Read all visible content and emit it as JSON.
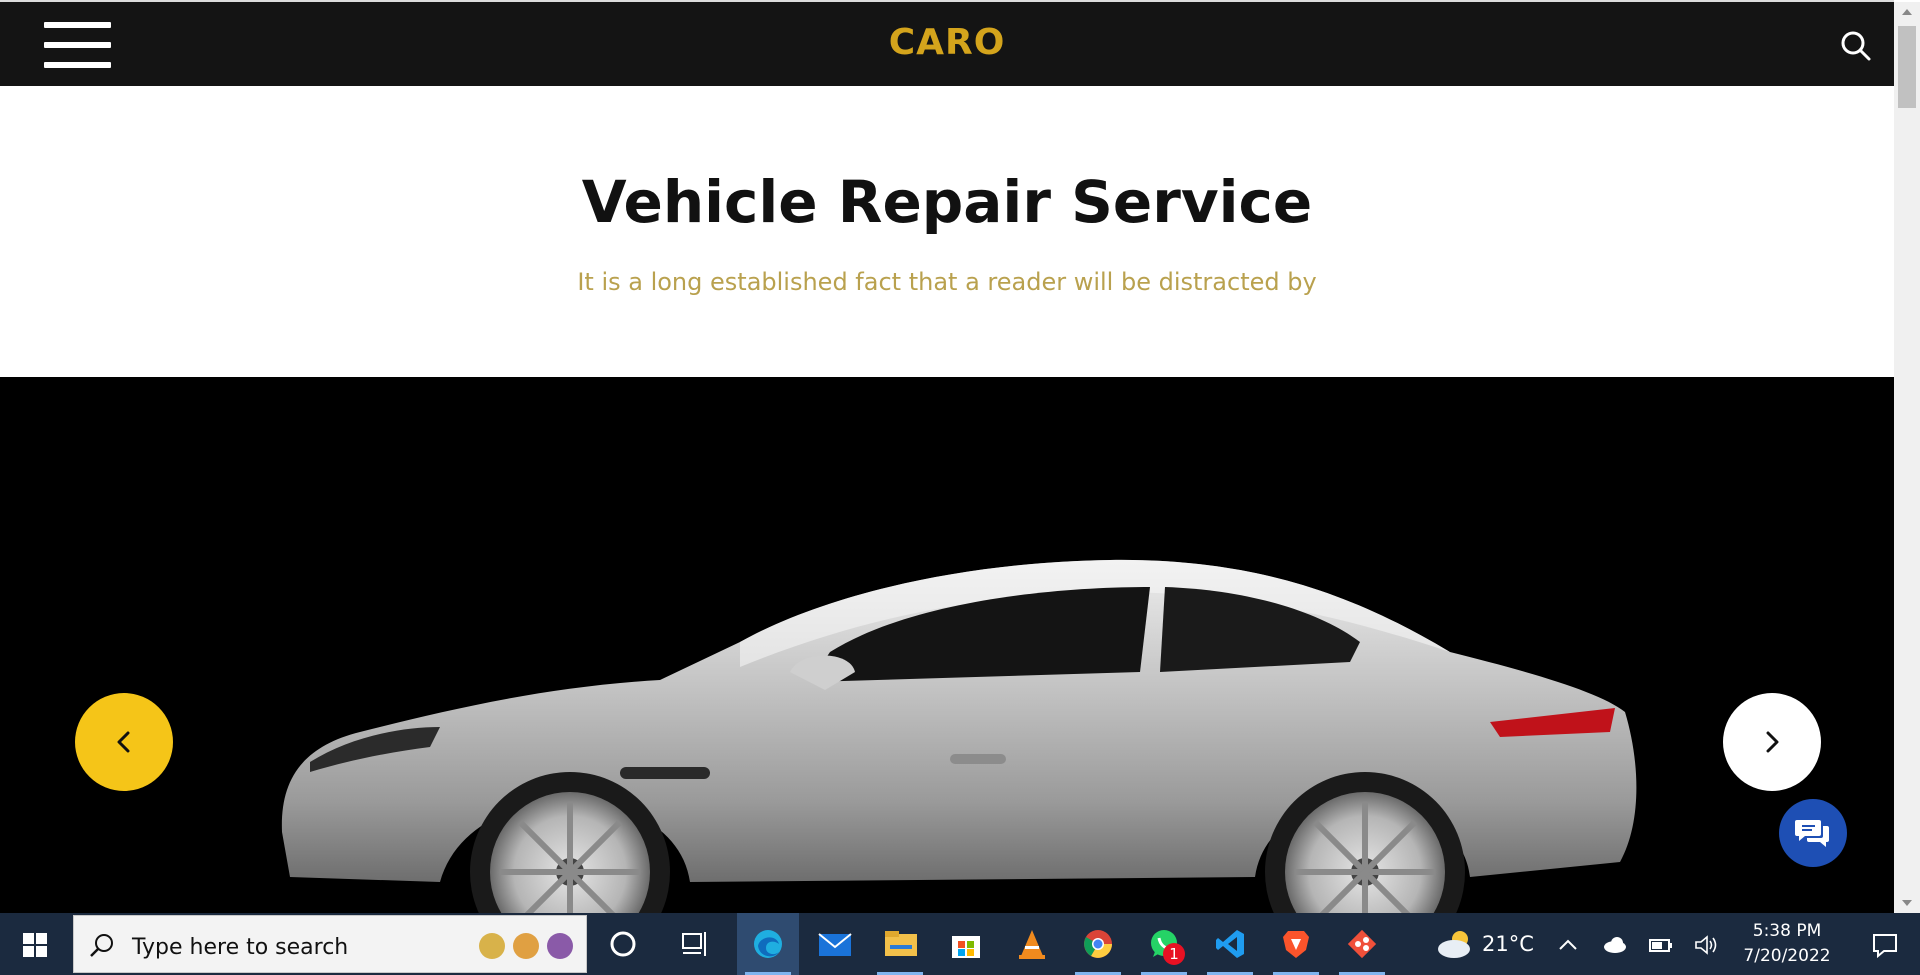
{
  "header": {
    "brand": "CARO",
    "brand_color": "#d4a41c",
    "menu_icon": "hamburger-icon",
    "search_icon": "search-icon"
  },
  "hero": {
    "title": "Vehicle Repair Service",
    "subtitle": "It is a long established fact that a reader will be distracted by",
    "subtitle_color": "#b9a14e"
  },
  "slider": {
    "prev_icon": "chevron-left-icon",
    "next_icon": "chevron-right-icon",
    "prev_color": "#f5c518",
    "next_color": "#ffffff",
    "image": "silver sports car"
  },
  "chat": {
    "icon": "chat-icon",
    "color": "#1e4fb4"
  },
  "taskbar": {
    "search_placeholder": "Type here to search",
    "apps": [
      "cortana-icon",
      "task-view-icon",
      "edge-icon",
      "mail-icon",
      "file-explorer-icon",
      "store-icon",
      "vlc-icon",
      "chrome-icon",
      "whatsapp-icon",
      "vscode-icon",
      "brave-icon",
      "git-icon"
    ],
    "whatsapp_badge": "1",
    "weather_temp": "21°C",
    "time": "5:38 PM",
    "date": "7/20/2022"
  }
}
